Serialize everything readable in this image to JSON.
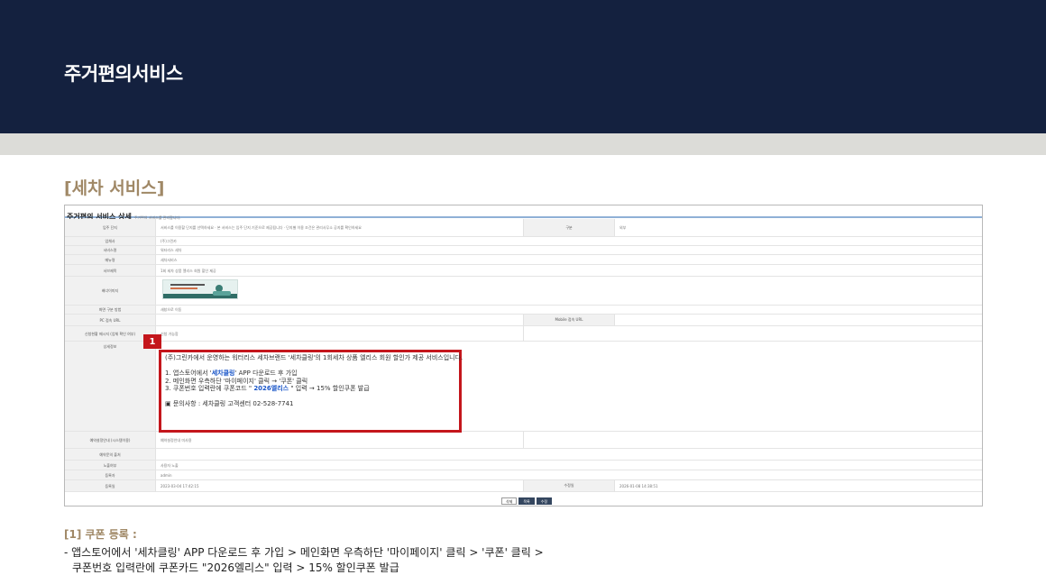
{
  "banner": {
    "title": "주거편의서비스"
  },
  "section": {
    "title": "[세차 서비스]"
  },
  "screenshot": {
    "header_title": "주거편의 서비스 상세",
    "header_sub": "주거편의 서비스를 관리합니다.",
    "rows": {
      "r1": {
        "label": "입주 단지",
        "value": "서비스를 이용할 단지를 선택하세요 · 본 서비스는 입주 단지 기준으로 제공됩니다 · 단지별 이용 조건은 관리사무소 공지를 확인하세요",
        "label2": "구분",
        "value2": "외부"
      },
      "r2": {
        "label": "업체사",
        "value": "(주)그린카"
      },
      "r3": {
        "label": "서비스명",
        "value": "워터리스 세차"
      },
      "r4": {
        "label": "메뉴명",
        "value": "세차서비스"
      },
      "r5": {
        "label": "서브제목",
        "value": "1회 세차 상품 엘리스 회원 할인 제공"
      },
      "r6": {
        "label": "배너이미지"
      },
      "r7": {
        "label": "화면 구분 방법",
        "value": "새창으로 이동"
      },
      "r8": {
        "label": "PC 접속 URL",
        "label2": "Mobile 접속 URL"
      },
      "r9": {
        "label": "신청현황 메시지\n(업체 확인 여부)",
        "value": "신청 가능함"
      },
      "r10": {
        "label": "상세정보"
      },
      "r11": {
        "label": "예약설정안내\n(시스템이용)",
        "value": "예약설정안내 미사용"
      },
      "r12": {
        "label": "예약문의 출처"
      },
      "r13": {
        "label": "노출여부",
        "value": "사용자 노출"
      },
      "r14": {
        "label": "등록자",
        "value": "admin"
      },
      "r15": {
        "label": "등록일",
        "value": "2023-03-04 17:42:15",
        "label2": "수정일",
        "value2": "2026-01-08 14:38:51"
      }
    },
    "thumb_text": "1회세차 엘리스 회원 할인",
    "buttons": {
      "b1": "삭제",
      "b2": "목록",
      "b3": "수정"
    }
  },
  "marker": {
    "number": "1"
  },
  "detail": {
    "line1": "(주)그린카에서 운영하는 워터리스 세차브랜드 '세차클링'의 1회세차 상품 엘리스 회원 할인가 제공 서비스입니다.",
    "line2_pre": "1. 앱스토어에서 '",
    "line2_app": "세차클링",
    "line2_post": "' APP 다운로드 후 가입",
    "line3": "2. 메인화면 우측하단 '마이페이지' 클릭 → '쿠폰' 클릭",
    "line4_pre": "3. 쿠폰번호 입력란에 쿠폰코드 \" ",
    "line4_code": "2026엘리스",
    "line4_post": " \" 입력 → 15% 할인쿠폰 발급",
    "line5": "▣ 문의사항 : 세차클링 고객센터 02-528-7741"
  },
  "note": {
    "title": "[1] 쿠폰 등록 :",
    "line1": "- 앱스토어에서 '세차클링' APP 다운로드 후 가입 > 메인화면 우측하단 '마이페이지' 클릭 > '쿠폰' 클릭 >",
    "line2": "쿠폰번호 입력란에 쿠폰카드 \"2026엘리스\" 입력 > 15% 할인쿠폰 발급"
  }
}
